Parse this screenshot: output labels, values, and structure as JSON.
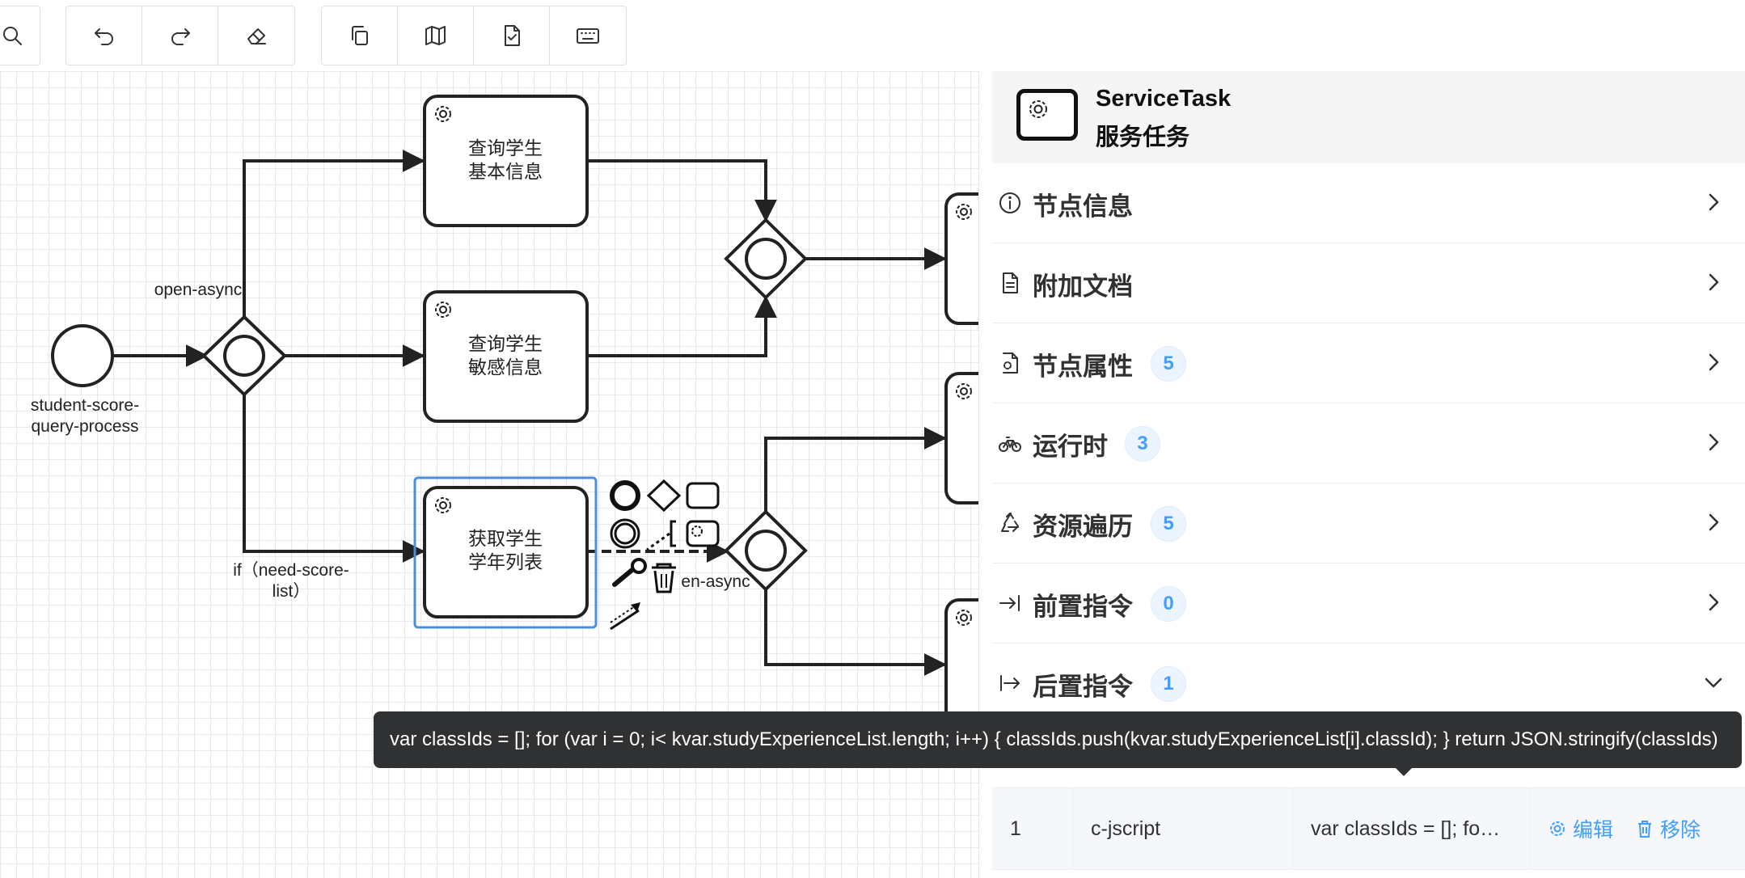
{
  "toolbar": {
    "groups": [
      [
        "zoom-icon"
      ],
      [
        "undo-icon",
        "redo-icon",
        "eraser-icon"
      ],
      [
        "copy-icon",
        "map-icon",
        "file-check-icon",
        "keyboard-icon"
      ]
    ]
  },
  "diagram": {
    "start_event_label_1": "student-score-",
    "start_event_label_2": "query-process",
    "flow_open_async_1": "open-async",
    "flow_if_need_score_1": "if（need-score-",
    "flow_if_need_score_2": "list）",
    "flow_open_async_2": "en-async",
    "tasks": [
      {
        "line1": "查询学生",
        "line2": "基本信息"
      },
      {
        "line1": "查询学生",
        "line2": "敏感信息"
      },
      {
        "line1": "获取学生",
        "line2": "学年列表"
      }
    ]
  },
  "panel": {
    "header": {
      "title": "ServiceTask",
      "subtitle": "服务任务",
      "icon": "service-task-icon"
    },
    "sections": [
      {
        "label": "节点信息",
        "icon": "info-icon",
        "badge": null,
        "expanded": false
      },
      {
        "label": "附加文档",
        "icon": "document-icon",
        "badge": null,
        "expanded": false
      },
      {
        "label": "节点属性",
        "icon": "file-gear-icon",
        "badge": "5",
        "expanded": false
      },
      {
        "label": "运行时",
        "icon": "bike-icon",
        "badge": "3",
        "expanded": false
      },
      {
        "label": "资源遍历",
        "icon": "recycle-icon",
        "badge": "5",
        "expanded": false
      },
      {
        "label": "前置指令",
        "icon": "arrow-to-line-icon",
        "badge": "0",
        "expanded": false
      },
      {
        "label": "后置指令",
        "icon": "arrow-from-line-icon",
        "badge": "1",
        "expanded": true
      }
    ],
    "table": {
      "row": {
        "index": "1",
        "type": "c-jscript",
        "value": "var classIds = []; fo…",
        "edit_label": "编辑",
        "remove_label": "移除"
      }
    }
  },
  "tooltip": {
    "text": "var classIds = []; for (var i = 0; i< kvar.studyExperienceList.length; i++) { classIds.push(kvar.studyExperienceList[i].classId); } return JSON.stringify(classIds)"
  },
  "colors": {
    "accent": "#409eff",
    "selection": "#4a90e2",
    "tooltip_bg": "#303133",
    "header_bg": "#f5f5f5"
  }
}
